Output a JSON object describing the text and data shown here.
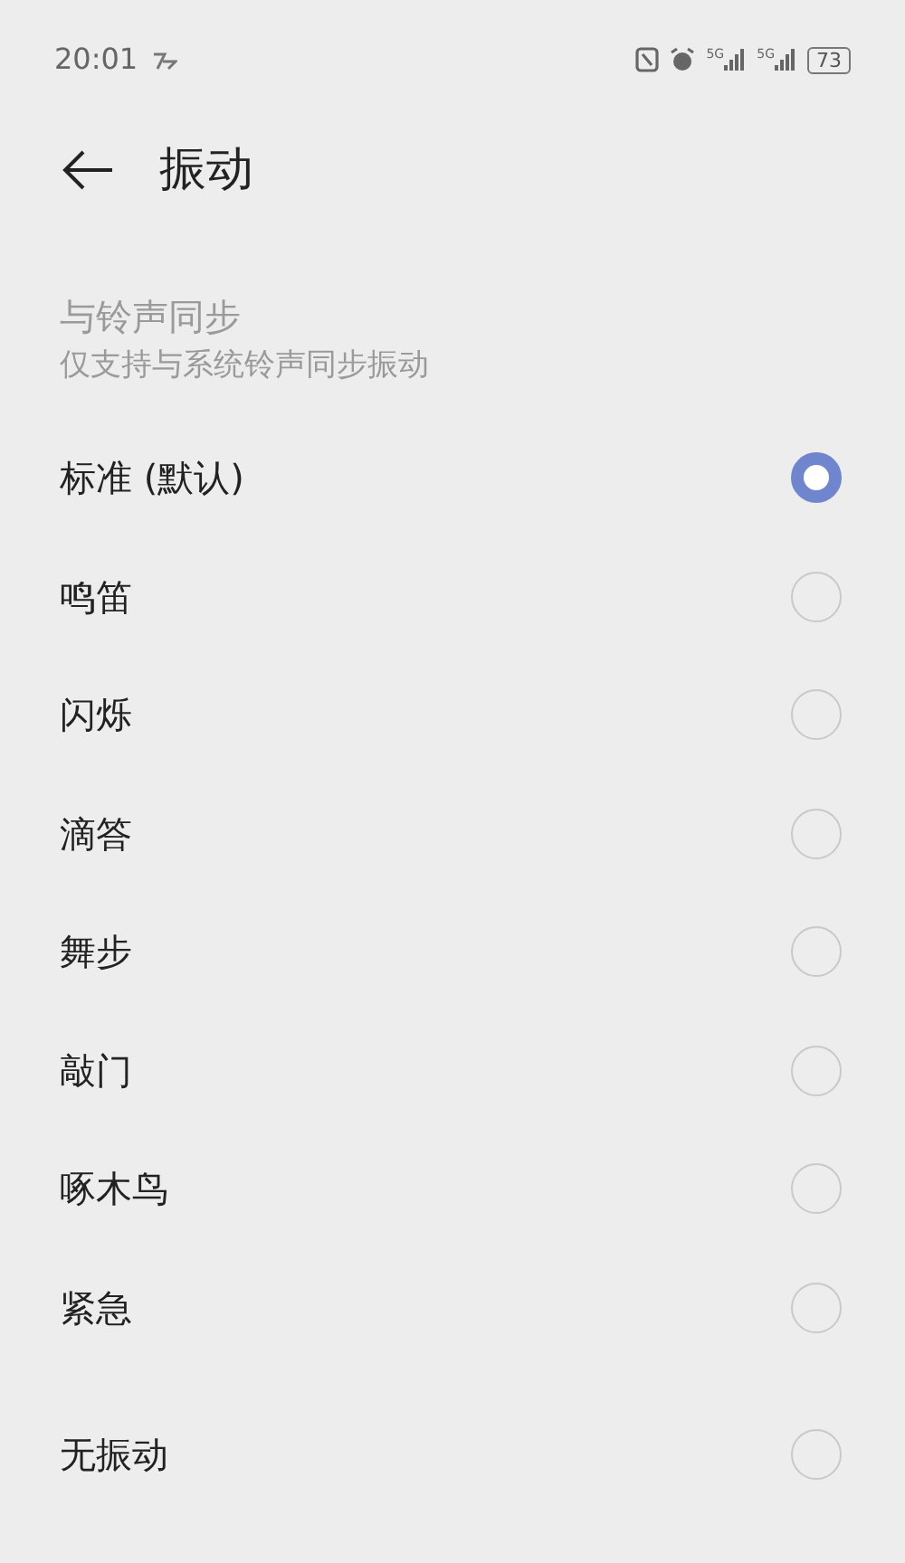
{
  "status_bar": {
    "time": "20:01",
    "signals": [
      "5G",
      "5G"
    ],
    "battery": "73"
  },
  "header": {
    "title": "振动"
  },
  "sync": {
    "title": "与铃声同步",
    "subtitle": "仅支持与系统铃声同步振动",
    "disabled": true
  },
  "options": [
    {
      "label": "标准 (默认)",
      "selected": true
    },
    {
      "label": "鸣笛",
      "selected": false
    },
    {
      "label": "闪烁",
      "selected": false
    },
    {
      "label": "滴答",
      "selected": false
    },
    {
      "label": "舞步",
      "selected": false
    },
    {
      "label": "敲门",
      "selected": false
    },
    {
      "label": "啄木鸟",
      "selected": false
    },
    {
      "label": "紧急",
      "selected": false
    }
  ],
  "extra_options": [
    {
      "label": "无振动",
      "selected": false
    }
  ]
}
